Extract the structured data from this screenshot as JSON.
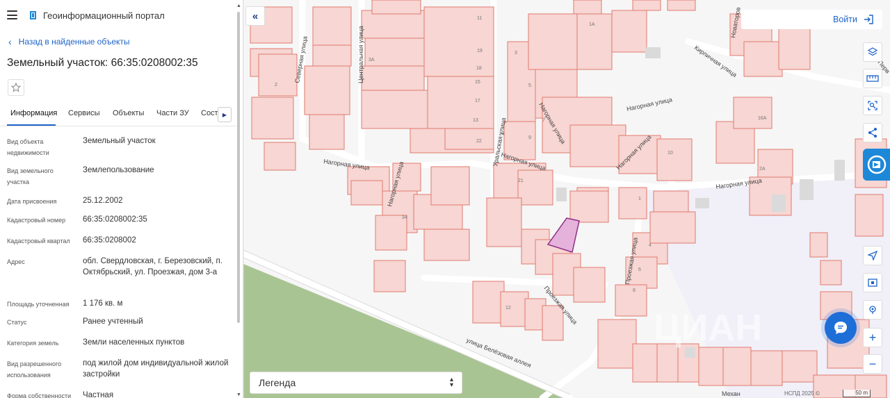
{
  "portal": {
    "title": "Геоинформационный портал"
  },
  "nav": {
    "back_label": "Назад в найденные объекты"
  },
  "object": {
    "title": "Земельный участок: 66:35:0208002:35"
  },
  "tabs": [
    {
      "label": "Информация",
      "active": true
    },
    {
      "label": "Сервисы"
    },
    {
      "label": "Объекты"
    },
    {
      "label": "Части ЗУ"
    },
    {
      "label": "Сост"
    }
  ],
  "properties": [
    {
      "label": "Вид объекта недвижимости",
      "value": "Земельный участок"
    },
    {
      "label": "Вид земельного участка",
      "value": "Землепользование"
    },
    {
      "label": "Дата присвоения",
      "value": "25.12.2002"
    },
    {
      "label": "Кадастровый номер",
      "value": "66:35:0208002:35"
    },
    {
      "label": "Кадастровый квартал",
      "value": "66:35:0208002"
    },
    {
      "label": "Адрес",
      "value": "обл. Свердловская, г. Березовский, п. Октябрьский, ул. Проезжая, дом 3-а"
    },
    {
      "label": "Площадь уточненная",
      "value": "1 176 кв. м"
    },
    {
      "label": "Статус",
      "value": "Ранее учтенный"
    },
    {
      "label": "Категория земель",
      "value": "Земли населенных пунктов"
    },
    {
      "label": "Вид разрешенного использования",
      "value": "под жилой дом индивидуальной жилой застройки"
    },
    {
      "label": "Форма собственности",
      "value": "Частная"
    }
  ],
  "header": {
    "login_label": "Войти"
  },
  "map": {
    "streets": [
      "Северная улица",
      "Центральная улица",
      "Нагорная улица",
      "Уральская улица",
      "Кирпичная улица",
      "Проезжая улица",
      "улица Белёзовая аллея",
      "Перв",
      "Новаторов",
      "Механ"
    ],
    "parcel_numbers": [
      "11",
      "19",
      "1А",
      "3",
      "5",
      "10",
      "7",
      "2А",
      "16А",
      "4",
      "6",
      "8",
      "12",
      "34",
      "3А",
      "1",
      "18",
      "21",
      "22",
      "24",
      "13",
      "15",
      "17",
      "2",
      "9"
    ],
    "watermark": "ЦИАН",
    "highlight_color": "#e5b2dc",
    "parcel_fill": "#f7d6d3",
    "parcel_stroke": "#e07a6e",
    "attribution": "НСПД 2025 ©",
    "scale_label": "50 m"
  },
  "legend": {
    "label": "Легенда"
  },
  "tools": [
    "layers-icon",
    "ruler-icon",
    "select-area-icon",
    "share-icon",
    "portal-logo-icon",
    "locate-icon",
    "print-icon",
    "target-icon",
    "zoom-in-icon",
    "zoom-out-icon"
  ],
  "chat": {
    "icon": "chat-icon"
  }
}
